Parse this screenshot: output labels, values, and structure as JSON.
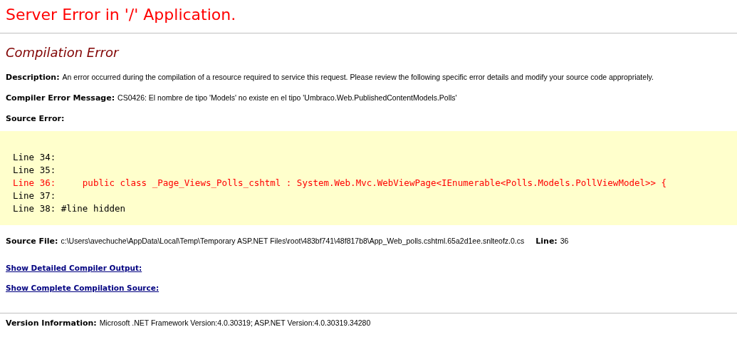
{
  "title": "Server Error in '/' Application.",
  "subtitle": "Compilation Error",
  "description": {
    "label": "Description:",
    "text": "An error occurred during the compilation of a resource required to service this request. Please review the following specific error details and modify your source code appropriately."
  },
  "compiler_message": {
    "label": "Compiler Error Message:",
    "text": "CS0426: El nombre de tipo 'Models' no existe en el tipo 'Umbraco.Web.PublishedContentModels.Polls'"
  },
  "source_error_label": "Source Error:",
  "source_lines": [
    {
      "text": "Line 34:",
      "error": false
    },
    {
      "text": "Line 35:",
      "error": false
    },
    {
      "text": "Line 36:     public class _Page_Views_Polls_cshtml : System.Web.Mvc.WebViewPage<IEnumerable<Polls.Models.PollViewModel>> {",
      "error": true
    },
    {
      "text": "Line 37:",
      "error": false
    },
    {
      "text": "Line 38: #line hidden",
      "error": false
    }
  ],
  "source_file": {
    "label": "Source File:",
    "text": "c:\\Users\\avechuche\\AppData\\Local\\Temp\\Temporary ASP.NET Files\\root\\483bf741\\48f817b8\\App_Web_polls.cshtml.65a2d1ee.snlteofz.0.cs",
    "line_label": "Line:",
    "line": "36"
  },
  "links": [
    "Show Detailed Compiler Output:",
    "Show Complete Compilation Source:"
  ],
  "version": {
    "label": "Version Information:",
    "text": "Microsoft .NET Framework Version:4.0.30319; ASP.NET Version:4.0.30319.34280"
  }
}
